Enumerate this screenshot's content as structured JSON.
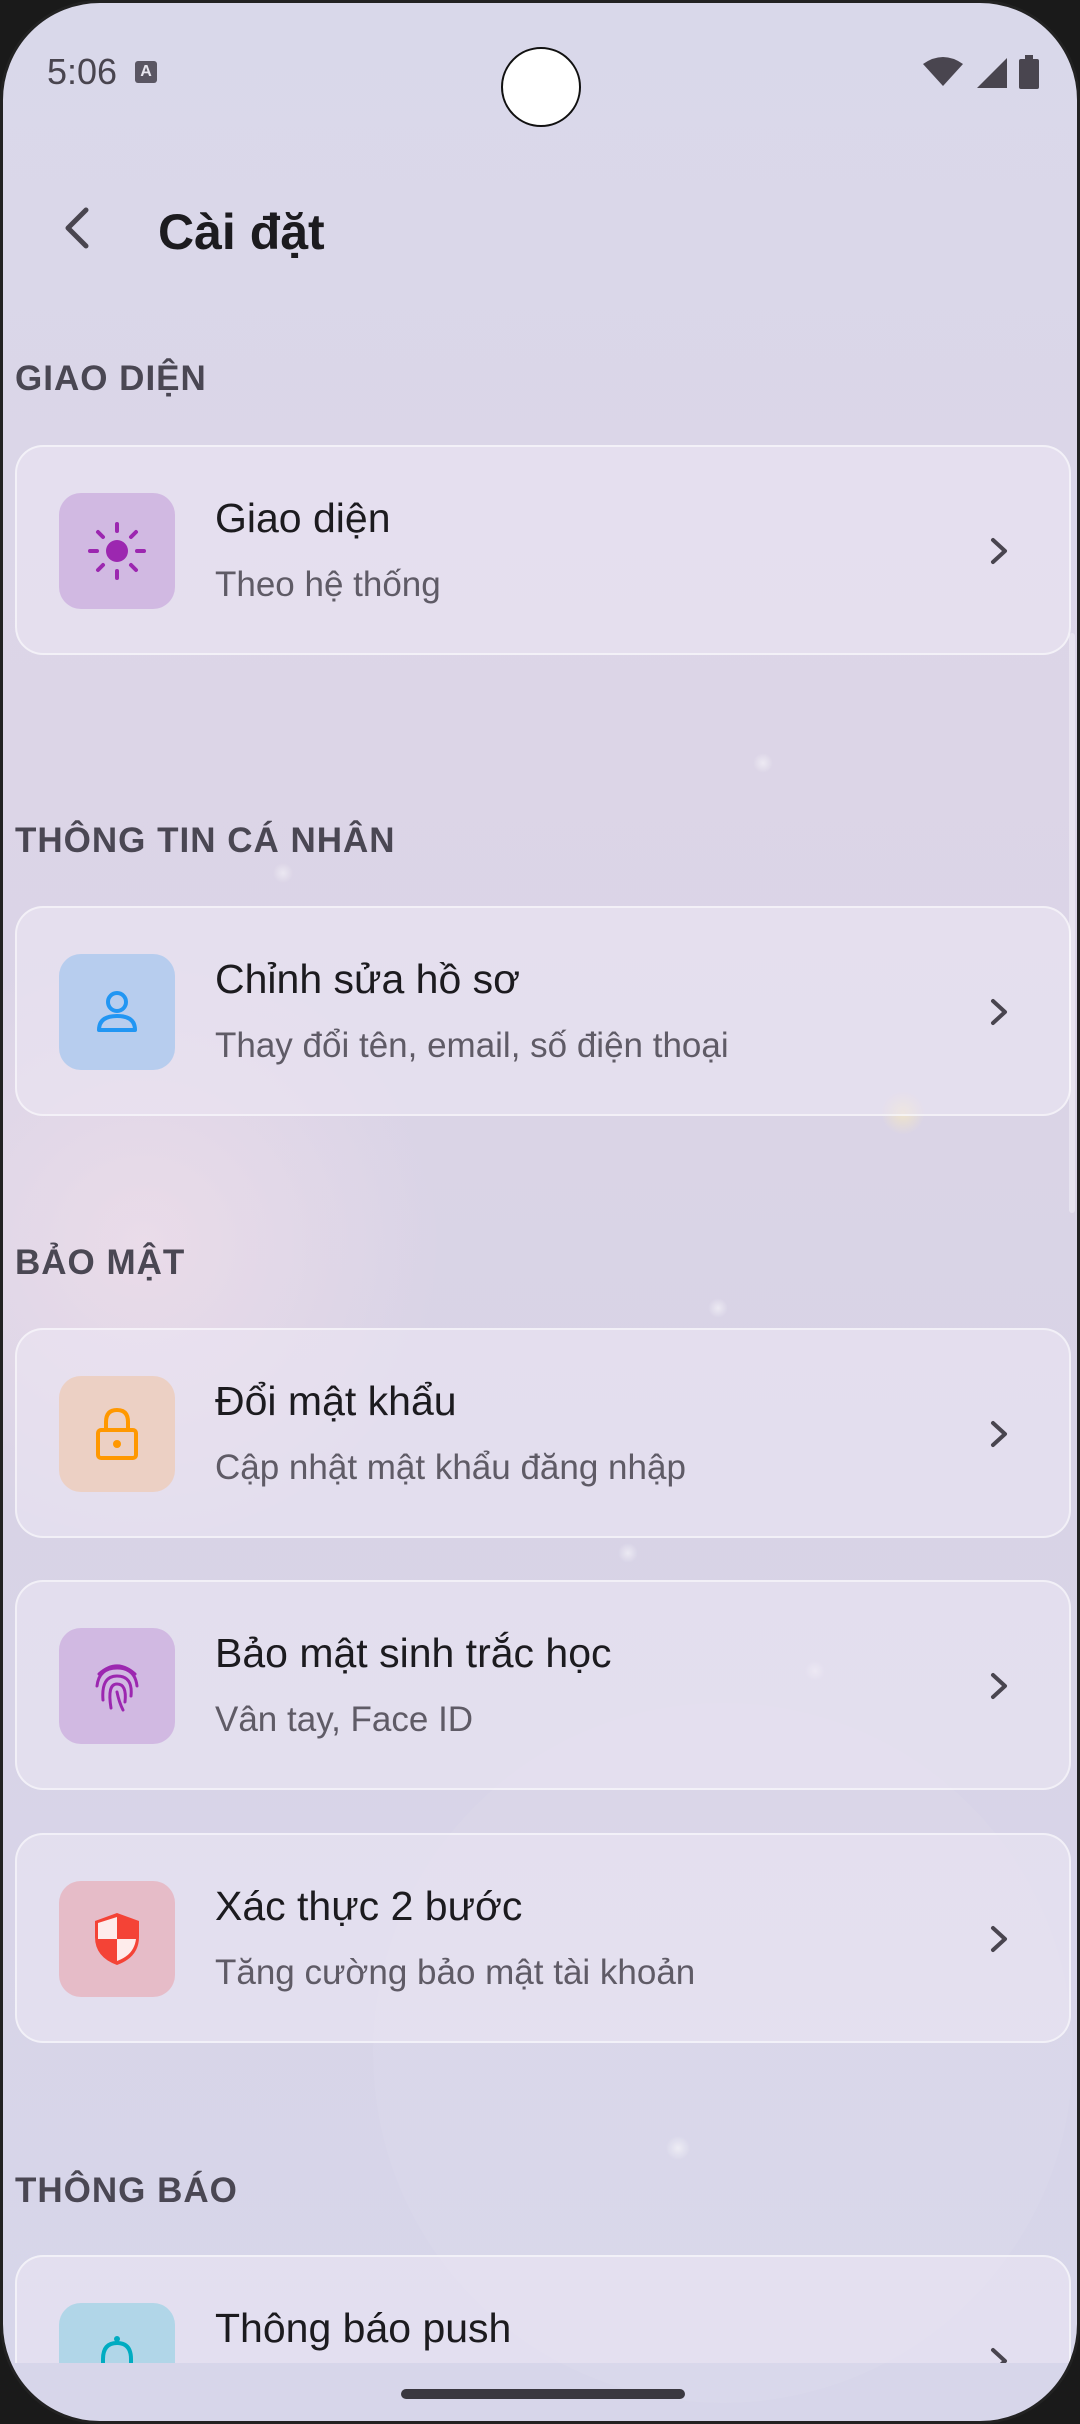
{
  "status_bar": {
    "time": "5:06",
    "notification_icon": "A"
  },
  "app_bar": {
    "title": "Cài đặt",
    "back_icon": "arrow-back-icon"
  },
  "sections": [
    {
      "header": "GIAO DIỆN",
      "items": [
        {
          "title": "Giao diện",
          "subtitle": "Theo hệ thống",
          "icon": "sun-icon",
          "icon_color": "#9c27b0",
          "icon_bg": "#d1b9e2"
        }
      ]
    },
    {
      "header": "THÔNG TIN CÁ NHÂN",
      "items": [
        {
          "title": "Chỉnh sửa hồ sơ",
          "subtitle": "Thay đổi tên, email, số điện thoại",
          "icon": "person-icon",
          "icon_color": "#2196f3",
          "icon_bg": "#b7cdee"
        }
      ]
    },
    {
      "header": "BẢO MẬT",
      "items": [
        {
          "title": "Đổi mật khẩu",
          "subtitle": "Cập nhật mật khẩu đăng nhập",
          "icon": "lock-icon",
          "icon_color": "#ff9800",
          "icon_bg": "#ecd0c4"
        },
        {
          "title": "Bảo mật sinh trắc học",
          "subtitle": "Vân tay, Face ID",
          "icon": "fingerprint-icon",
          "icon_color": "#9c27b0",
          "icon_bg": "#d1b9e2"
        },
        {
          "title": "Xác thực 2 bước",
          "subtitle": "Tăng cường bảo mật tài khoản",
          "icon": "shield-icon",
          "icon_color": "#f44336",
          "icon_bg": "#e6bcc8"
        }
      ]
    },
    {
      "header": "THÔNG BÁO",
      "items": [
        {
          "title": "Thông báo push",
          "subtitle": "",
          "icon": "bell-icon",
          "icon_color": "#00acc1",
          "icon_bg": "#b1d6e8"
        }
      ]
    }
  ]
}
